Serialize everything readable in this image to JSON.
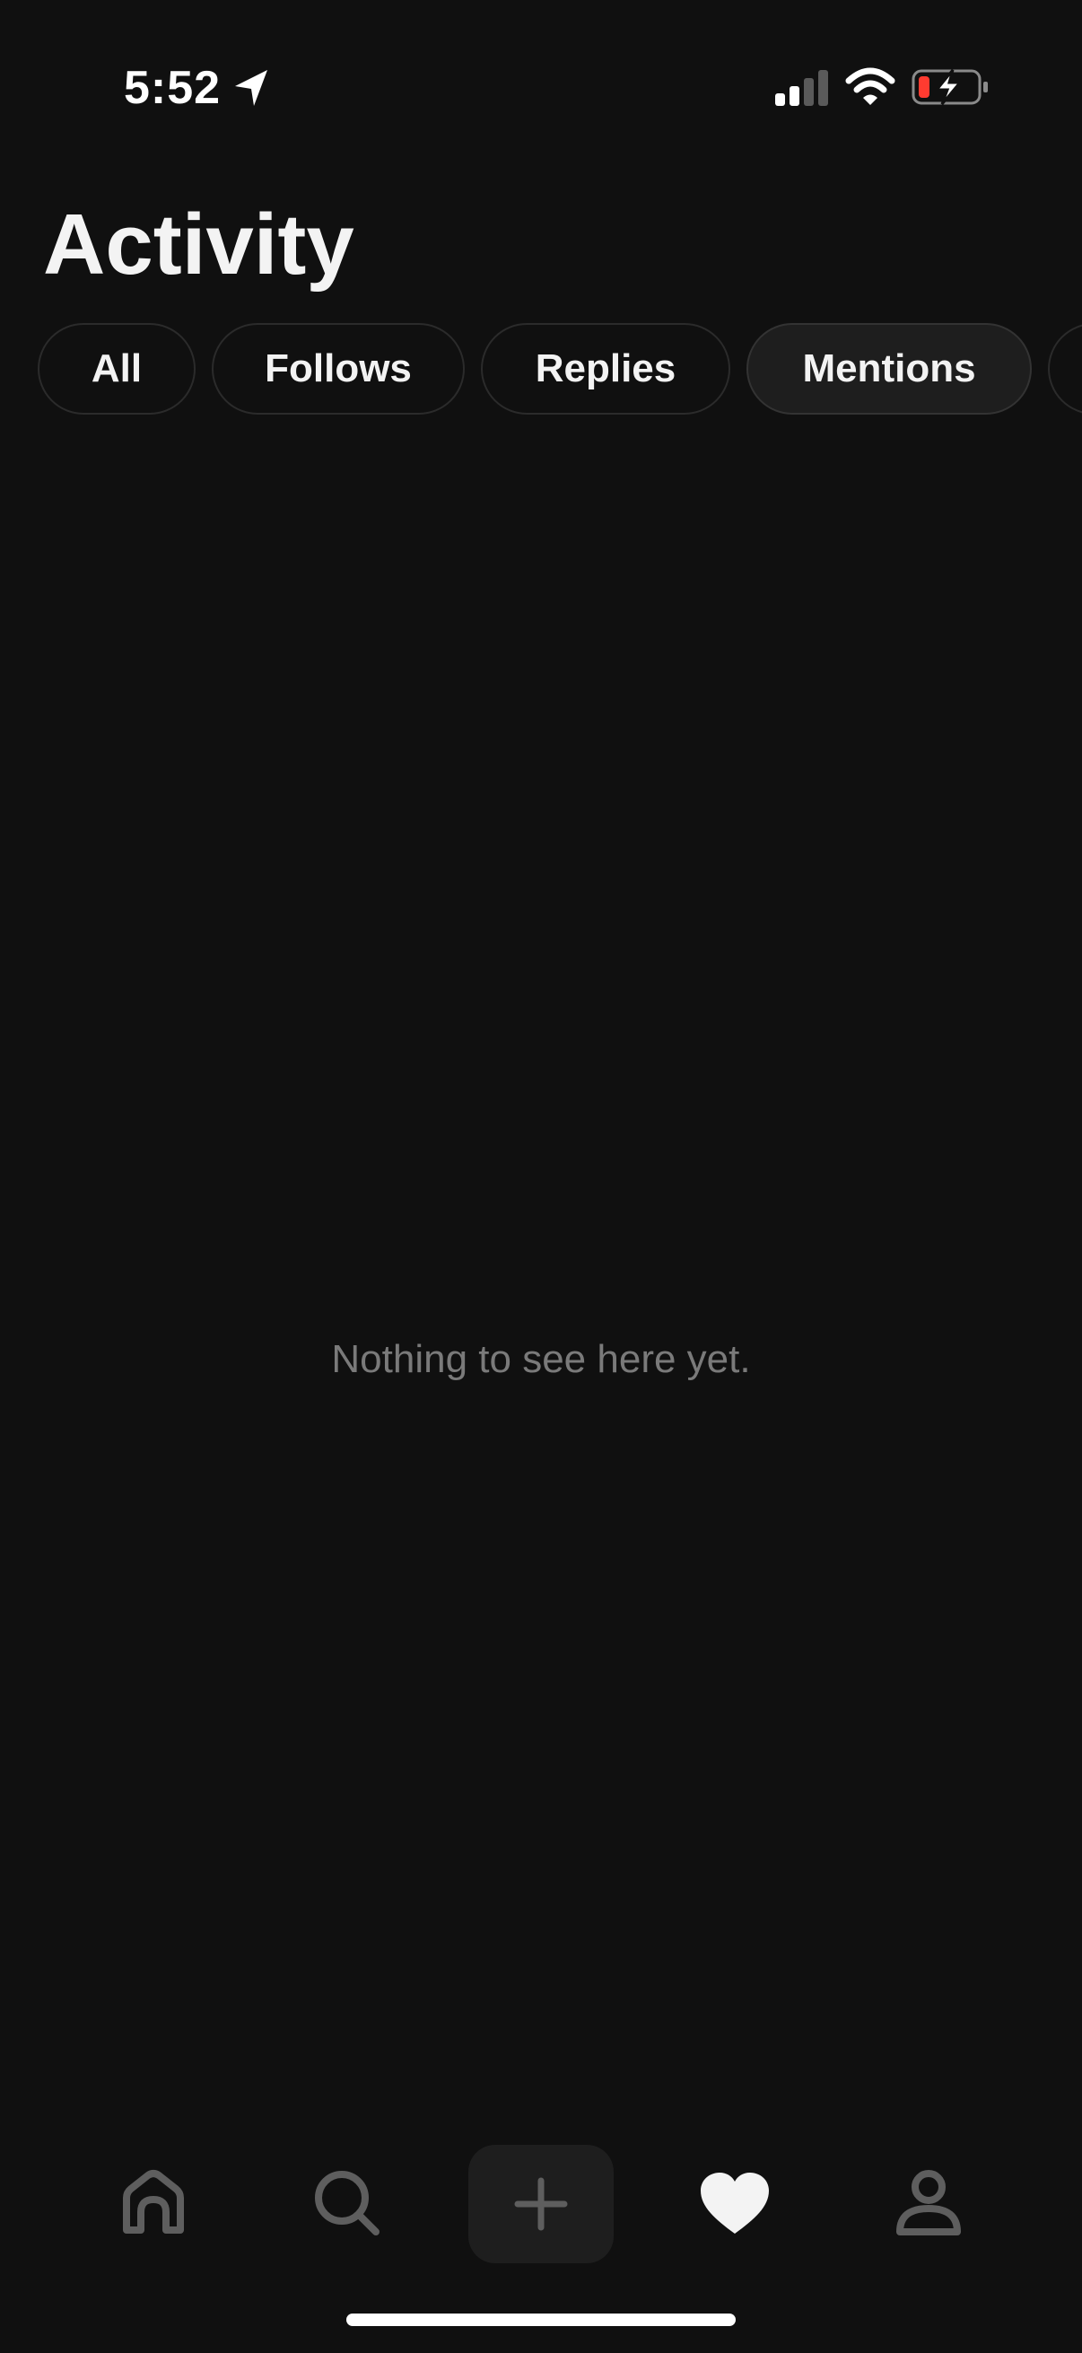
{
  "status_bar": {
    "time": "5:52",
    "icons": [
      "location-arrow-icon",
      "signal-icon",
      "wifi-icon",
      "battery-charging-icon"
    ],
    "battery_low_color": "#ff3b30"
  },
  "header": {
    "title": "Activity"
  },
  "filters": {
    "chips": [
      {
        "label": "All",
        "active": false
      },
      {
        "label": "Follows",
        "active": false
      },
      {
        "label": "Replies",
        "active": false
      },
      {
        "label": "Mentions",
        "active": true
      },
      {
        "label": "",
        "active": false
      }
    ]
  },
  "main": {
    "empty_message": "Nothing to see here yet."
  },
  "tab_bar": {
    "items": [
      {
        "icon": "home-icon",
        "selected": false
      },
      {
        "icon": "search-icon",
        "selected": false
      },
      {
        "icon": "plus-icon",
        "selected": false
      },
      {
        "icon": "heart-icon",
        "selected": true
      },
      {
        "icon": "profile-icon",
        "selected": false
      }
    ]
  },
  "colors": {
    "background": "#101010",
    "text_primary": "#f3f3f3",
    "text_muted": "#7a7a7a",
    "chip_border": "#2b2b2b",
    "chip_active_bg": "#1e1e1e",
    "icon_inactive": "#5e5e5e"
  }
}
